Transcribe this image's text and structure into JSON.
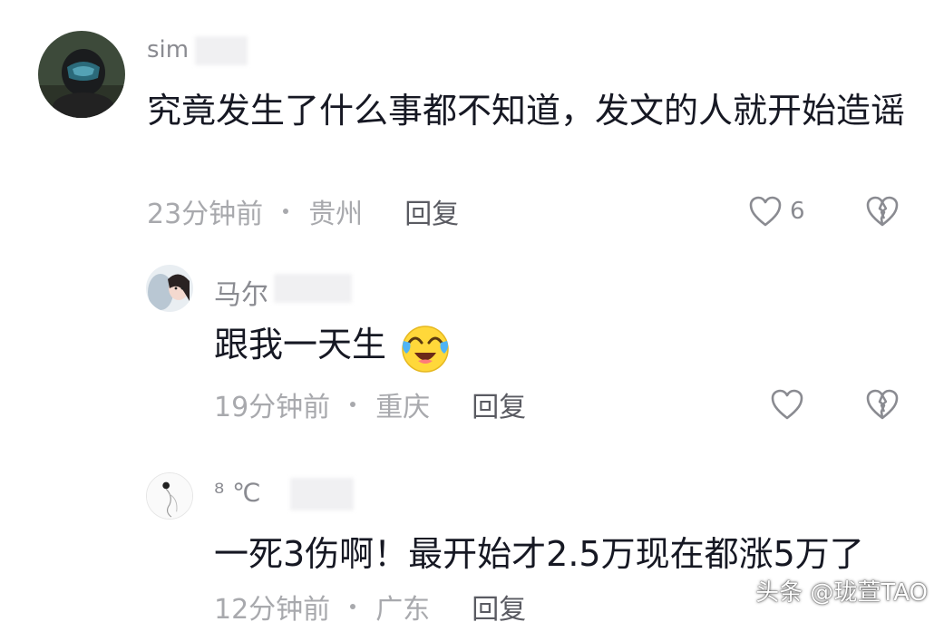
{
  "comments": [
    {
      "username": "sim",
      "text": "究竟发生了什么事都不知道，发文的人就开始造谣",
      "time": "23分钟前",
      "location": "贵州",
      "reply_label": "回复",
      "like_count": "6"
    },
    {
      "username": "马尔",
      "text": "跟我一天生",
      "emoji": "crying-laughing-emoji",
      "time": "19分钟前",
      "location": "重庆",
      "reply_label": "回复"
    },
    {
      "username": "⁸ ℃",
      "text": "一死3伤啊！最开始才2.5万现在都涨5万了",
      "time": "12分钟前",
      "location": "广东",
      "reply_label": "回复"
    }
  ],
  "watermark": "头条 @珑萱TAO",
  "colors": {
    "text": "#161823",
    "muted": "#a8a9ad",
    "username": "#8a8b91",
    "background": "#ffffff"
  }
}
